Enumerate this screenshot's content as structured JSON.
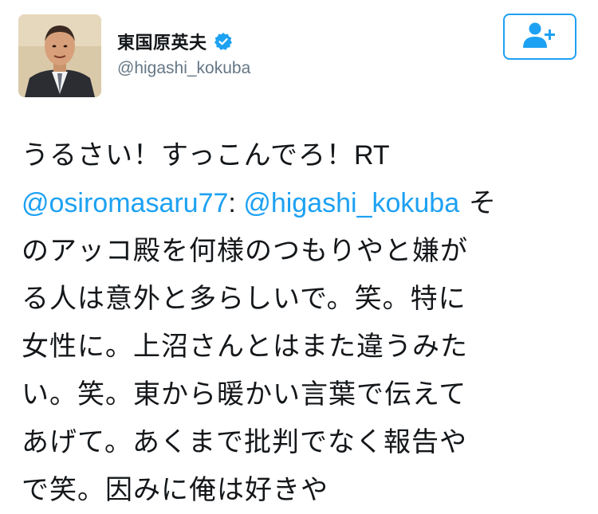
{
  "author": {
    "display_name": "東国原英夫",
    "handle": "@higashi_kokuba"
  },
  "icons": {
    "verified": "verified-badge-icon",
    "follow": "add-person-icon"
  },
  "colors": {
    "link": "#1da1f2",
    "text": "#14171a",
    "handle": "#657786"
  },
  "tweet": {
    "line1": "うるさい！すっこんでろ！",
    "rt": "RT",
    "mention1": "@osiromasaru77",
    "colon": ": ",
    "mention2": "@higashi_kokuba",
    "line2_tail": " そ",
    "line3": "のアッコ殿を何様のつもりやと嫌が",
    "line4": "る人は意外と多らしいで。笑。特に",
    "line5": "女性に。上沼さんとはまた違うみた",
    "line6": "い。笑。東から暖かい言葉で伝えて",
    "line7": "あげて。あくまで批判でなく報告や",
    "line8": "で笑。因みに俺は好きや"
  }
}
